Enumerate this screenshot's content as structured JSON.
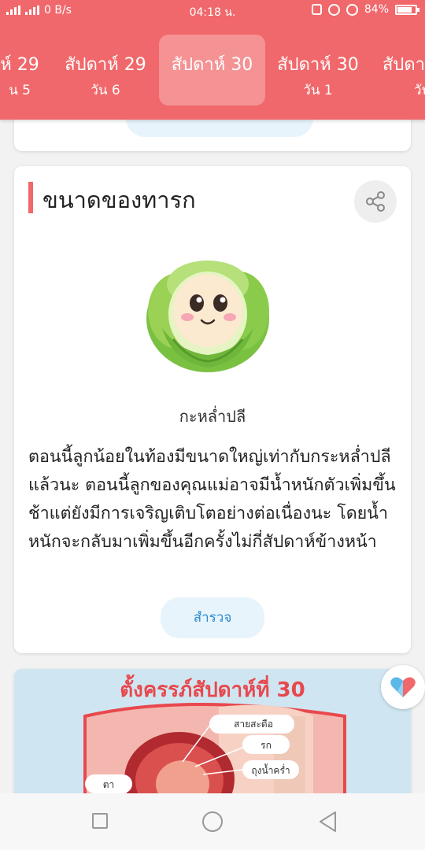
{
  "status_bar": {
    "network_speed": "0 B/s",
    "time": "04:18 น.",
    "battery": "84%",
    "battery_level": 0.84
  },
  "week_tabs": [
    {
      "week": "ห์ 29",
      "day": "น 5"
    },
    {
      "week": "สัปดาห์ 29",
      "day": "วัน 6"
    },
    {
      "week": "สัปดาห์ 30",
      "day": ""
    },
    {
      "week": "สัปดาห์ 30",
      "day": "วัน 1"
    },
    {
      "week": "สัปดา",
      "day": "วัน"
    }
  ],
  "size_card": {
    "title": "ขนาดของทารก",
    "produce_name": "กะหล่ำปลี",
    "description": "ตอนนี้ลูกน้อยในท้องมีขนาดใหญ่เท่ากับกระหล่ำปลีแล้วนะ ตอนนี้ลูกของคุณแม่อาจมีน้ำหนักตัวเพิ่มขึ้นช้าแต่ยังมีการเจริญเติบโตอย่างต่อเนื่องนะ โดยน้ำหนักจะกลับมาเพิ่มขึ้นอีกครั้งไม่กี่สัปดาห์ข้างหน้า",
    "explore_button": "สำรวจ"
  },
  "image_card": {
    "heading": "ตั้งครรภ์สัปดาห์ที่ 30",
    "labels": [
      "สายสะดือ",
      "รก",
      "ถุงน้ำคร่ำ",
      "ตา"
    ]
  },
  "colors": {
    "header": "#f0686b",
    "accent_blue": "#2a8ad2",
    "heading_red": "#e8484d"
  }
}
